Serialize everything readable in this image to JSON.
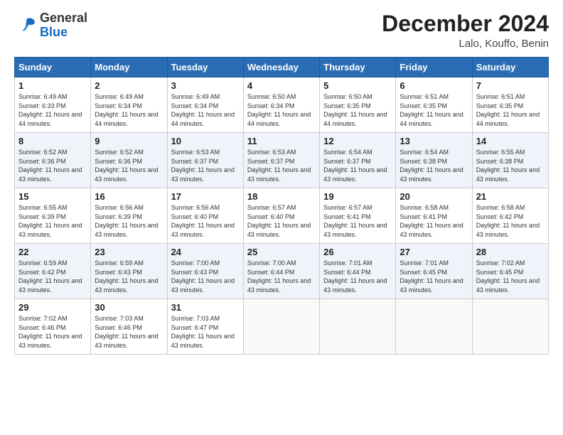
{
  "logo": {
    "general": "General",
    "blue": "Blue"
  },
  "header": {
    "month": "December 2024",
    "location": "Lalo, Kouffo, Benin"
  },
  "days_of_week": [
    "Sunday",
    "Monday",
    "Tuesday",
    "Wednesday",
    "Thursday",
    "Friday",
    "Saturday"
  ],
  "weeks": [
    [
      {
        "day": "1",
        "sunrise": "6:49 AM",
        "sunset": "6:33 PM",
        "daylight": "11 hours and 44 minutes."
      },
      {
        "day": "2",
        "sunrise": "6:49 AM",
        "sunset": "6:34 PM",
        "daylight": "11 hours and 44 minutes."
      },
      {
        "day": "3",
        "sunrise": "6:49 AM",
        "sunset": "6:34 PM",
        "daylight": "11 hours and 44 minutes."
      },
      {
        "day": "4",
        "sunrise": "6:50 AM",
        "sunset": "6:34 PM",
        "daylight": "11 hours and 44 minutes."
      },
      {
        "day": "5",
        "sunrise": "6:50 AM",
        "sunset": "6:35 PM",
        "daylight": "11 hours and 44 minutes."
      },
      {
        "day": "6",
        "sunrise": "6:51 AM",
        "sunset": "6:35 PM",
        "daylight": "11 hours and 44 minutes."
      },
      {
        "day": "7",
        "sunrise": "6:51 AM",
        "sunset": "6:35 PM",
        "daylight": "11 hours and 44 minutes."
      }
    ],
    [
      {
        "day": "8",
        "sunrise": "6:52 AM",
        "sunset": "6:36 PM",
        "daylight": "11 hours and 43 minutes."
      },
      {
        "day": "9",
        "sunrise": "6:52 AM",
        "sunset": "6:36 PM",
        "daylight": "11 hours and 43 minutes."
      },
      {
        "day": "10",
        "sunrise": "6:53 AM",
        "sunset": "6:37 PM",
        "daylight": "11 hours and 43 minutes."
      },
      {
        "day": "11",
        "sunrise": "6:53 AM",
        "sunset": "6:37 PM",
        "daylight": "11 hours and 43 minutes."
      },
      {
        "day": "12",
        "sunrise": "6:54 AM",
        "sunset": "6:37 PM",
        "daylight": "11 hours and 43 minutes."
      },
      {
        "day": "13",
        "sunrise": "6:54 AM",
        "sunset": "6:38 PM",
        "daylight": "11 hours and 43 minutes."
      },
      {
        "day": "14",
        "sunrise": "6:55 AM",
        "sunset": "6:38 PM",
        "daylight": "11 hours and 43 minutes."
      }
    ],
    [
      {
        "day": "15",
        "sunrise": "6:55 AM",
        "sunset": "6:39 PM",
        "daylight": "11 hours and 43 minutes."
      },
      {
        "day": "16",
        "sunrise": "6:56 AM",
        "sunset": "6:39 PM",
        "daylight": "11 hours and 43 minutes."
      },
      {
        "day": "17",
        "sunrise": "6:56 AM",
        "sunset": "6:40 PM",
        "daylight": "11 hours and 43 minutes."
      },
      {
        "day": "18",
        "sunrise": "6:57 AM",
        "sunset": "6:40 PM",
        "daylight": "11 hours and 43 minutes."
      },
      {
        "day": "19",
        "sunrise": "6:57 AM",
        "sunset": "6:41 PM",
        "daylight": "11 hours and 43 minutes."
      },
      {
        "day": "20",
        "sunrise": "6:58 AM",
        "sunset": "6:41 PM",
        "daylight": "11 hours and 43 minutes."
      },
      {
        "day": "21",
        "sunrise": "6:58 AM",
        "sunset": "6:42 PM",
        "daylight": "11 hours and 43 minutes."
      }
    ],
    [
      {
        "day": "22",
        "sunrise": "6:59 AM",
        "sunset": "6:42 PM",
        "daylight": "11 hours and 43 minutes."
      },
      {
        "day": "23",
        "sunrise": "6:59 AM",
        "sunset": "6:43 PM",
        "daylight": "11 hours and 43 minutes."
      },
      {
        "day": "24",
        "sunrise": "7:00 AM",
        "sunset": "6:43 PM",
        "daylight": "11 hours and 43 minutes."
      },
      {
        "day": "25",
        "sunrise": "7:00 AM",
        "sunset": "6:44 PM",
        "daylight": "11 hours and 43 minutes."
      },
      {
        "day": "26",
        "sunrise": "7:01 AM",
        "sunset": "6:44 PM",
        "daylight": "11 hours and 43 minutes."
      },
      {
        "day": "27",
        "sunrise": "7:01 AM",
        "sunset": "6:45 PM",
        "daylight": "11 hours and 43 minutes."
      },
      {
        "day": "28",
        "sunrise": "7:02 AM",
        "sunset": "6:45 PM",
        "daylight": "11 hours and 43 minutes."
      }
    ],
    [
      {
        "day": "29",
        "sunrise": "7:02 AM",
        "sunset": "6:46 PM",
        "daylight": "11 hours and 43 minutes."
      },
      {
        "day": "30",
        "sunrise": "7:03 AM",
        "sunset": "6:46 PM",
        "daylight": "11 hours and 43 minutes."
      },
      {
        "day": "31",
        "sunrise": "7:03 AM",
        "sunset": "6:47 PM",
        "daylight": "11 hours and 43 minutes."
      },
      null,
      null,
      null,
      null
    ]
  ]
}
